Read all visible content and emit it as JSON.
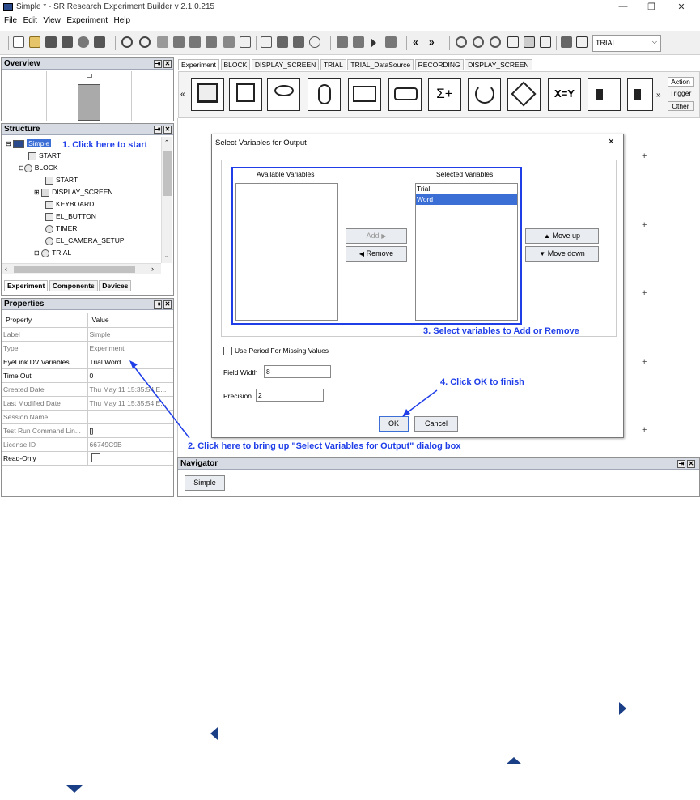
{
  "window": {
    "title": "Simple * - SR Research Experiment Builder v 2.1.0.215",
    "min": "—",
    "max": "❐",
    "close": "✕"
  },
  "menu": [
    "File",
    "Edit",
    "View",
    "Experiment",
    "Help"
  ],
  "toolbar": {
    "combo_value": "TRIAL"
  },
  "overview": {
    "title": "Overview"
  },
  "structure": {
    "title": "Structure",
    "items": [
      "Simple",
      "START",
      "BLOCK",
      "START",
      "DISPLAY_SCREEN",
      "KEYBOARD",
      "EL_BUTTON",
      "TIMER",
      "EL_CAMERA_SETUP",
      "TRIAL"
    ],
    "tabs": [
      "Experiment",
      "Components",
      "Devices"
    ]
  },
  "properties": {
    "title": "Properties",
    "header": [
      "Property",
      "Value"
    ],
    "rows": [
      {
        "property": "Label",
        "value": "Simple"
      },
      {
        "property": "Type",
        "value": "Experiment"
      },
      {
        "property": "EyeLink DV Variables",
        "value": "Trial Word"
      },
      {
        "property": "Time Out",
        "value": "0"
      },
      {
        "property": "Created Date",
        "value": "Thu May 11 15:35:54 E..."
      },
      {
        "property": "Last Modified Date",
        "value": "Thu May 11 15:35:54 E..."
      },
      {
        "property": "Session Name",
        "value": ""
      },
      {
        "property": "Test Run Command Lin...",
        "value": "[]"
      },
      {
        "property": "License ID",
        "value": "66749C9B"
      },
      {
        "property": "Read-Only",
        "value": ""
      }
    ]
  },
  "editor": {
    "tabs": [
      "Experiment",
      "BLOCK",
      "DISPLAY_SCREEN",
      "TRIAL",
      "TRIAL_DataSource",
      "RECORDING",
      "DISPLAY_SCREEN"
    ],
    "side_tabs": [
      "Action",
      "Trigger",
      "Other"
    ],
    "node_icons": [
      "display-icon",
      "display-small-icon",
      "eye-icon",
      "mouse-icon",
      "keyboard-icon",
      "eyelink-icon",
      "sum-icon",
      "loop-icon",
      "navigation-icon",
      "assign-icon",
      "sound-icon",
      "sound-out-icon"
    ],
    "node_labels": {
      "assign": "X=Y",
      "sum": "Σ+"
    }
  },
  "dialog": {
    "title": "Select Variables for Output",
    "close": "✕",
    "available_label": "Available Variables",
    "selected_label": "Selected Variables",
    "selected_items": [
      "Trial",
      "Word"
    ],
    "add": "Add",
    "remove": "Remove",
    "move_up": "Move up",
    "move_down": "Move down",
    "missing_label": "Use Period For Missing Values",
    "field_width_label": "Field Width",
    "field_width_value": "8",
    "precision_label": "Precision",
    "precision_value": "2",
    "ok": "OK",
    "cancel": "Cancel"
  },
  "navigator": {
    "title": "Navigator",
    "button": "Simple"
  },
  "annotations": {
    "a1": "1. Click here to start",
    "a2": "2. Click here to bring up \"Select Variables for Output\" dialog box",
    "a3": "3. Select variables to Add or Remove",
    "a4": "4. Click OK to finish",
    "color": "#1f3ee8"
  },
  "colors": {
    "selection": "#3b6fd6",
    "highlight_border": "#1f3ee8",
    "panel_header": "#d6dbe3"
  }
}
